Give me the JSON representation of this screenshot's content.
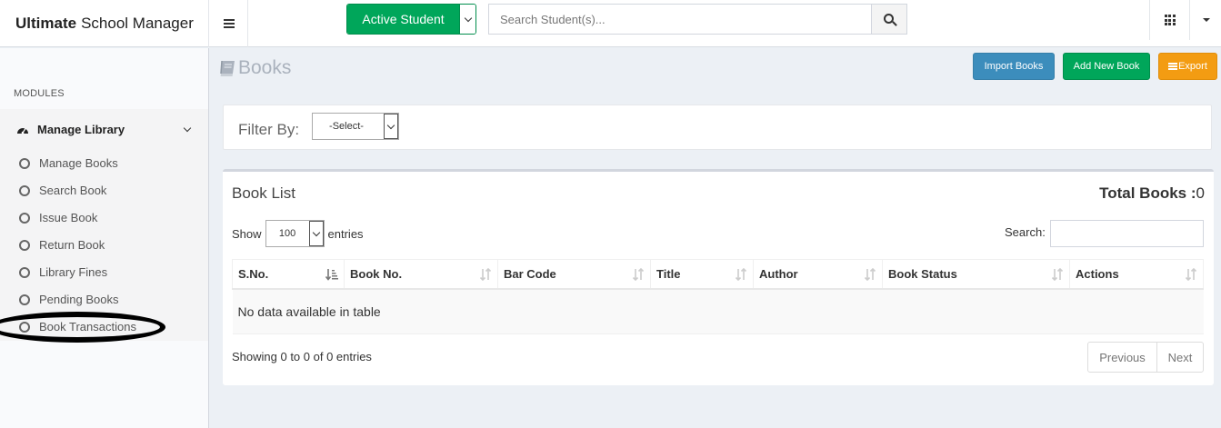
{
  "header": {
    "brand_bold": "Ultimate",
    "brand_rest": "School Manager",
    "student_filter": "Active Student",
    "search_placeholder": "Search Student(s)..."
  },
  "sidebar": {
    "section_label": "MODULES",
    "group_title": "Manage Library",
    "items": [
      {
        "label": "Manage Books"
      },
      {
        "label": "Search Book"
      },
      {
        "label": "Issue Book"
      },
      {
        "label": "Return Book"
      },
      {
        "label": "Library Fines"
      },
      {
        "label": "Pending Books"
      },
      {
        "label": "Book Transactions"
      }
    ]
  },
  "page": {
    "title": "Books",
    "actions": {
      "import": "Import Books",
      "add": "Add New Book",
      "export": "Export"
    }
  },
  "filter": {
    "label": "Filter By:",
    "selected": "-Select-"
  },
  "list": {
    "title": "Book List",
    "total_label": "Total Books :",
    "total_value": "0",
    "show_label": "Show",
    "page_length": "100",
    "entries_label": "entries",
    "search_label": "Search:",
    "columns": [
      "S.No.",
      "Book No.",
      "Bar Code",
      "Title",
      "Author",
      "Book Status",
      "Actions"
    ],
    "empty_message": "No data available in table",
    "info": "Showing 0 to 0 of 0 entries",
    "prev": "Previous",
    "next": "Next"
  },
  "colors": {
    "success": "#00a65a",
    "primary": "#3c8dbc",
    "warning": "#f39c12",
    "background": "#ecf0f5"
  }
}
